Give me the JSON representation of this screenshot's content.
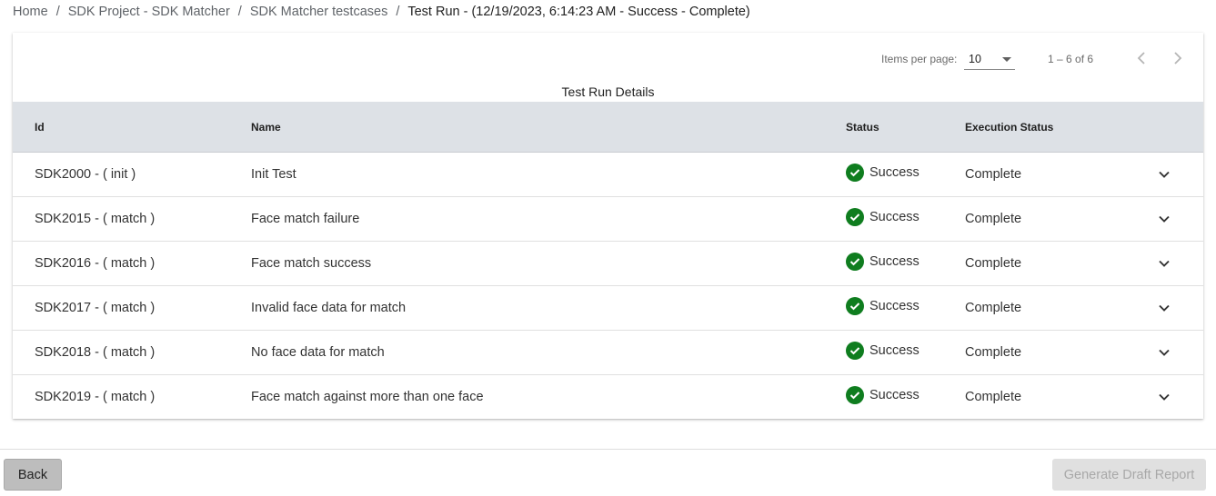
{
  "breadcrumb": [
    {
      "label": "Home"
    },
    {
      "label": "SDK Project - SDK Matcher"
    },
    {
      "label": "SDK Matcher testcases"
    },
    {
      "label": "Test Run - (12/19/2023, 6:14:23 AM - Success - Complete)"
    }
  ],
  "paginator": {
    "items_per_page_label": "Items per page:",
    "items_per_page_value": "10",
    "range_label": "1 – 6 of 6"
  },
  "table": {
    "title": "Test Run Details",
    "headers": {
      "id": "Id",
      "name": "Name",
      "status": "Status",
      "execution_status": "Execution Status"
    },
    "rows": [
      {
        "id": "SDK2000 - ( init )",
        "name": "Init Test",
        "status": "Success",
        "execution_status": "Complete"
      },
      {
        "id": "SDK2015 - ( match )",
        "name": "Face match failure",
        "status": "Success",
        "execution_status": "Complete"
      },
      {
        "id": "SDK2016 - ( match )",
        "name": "Face match success",
        "status": "Success",
        "execution_status": "Complete"
      },
      {
        "id": "SDK2017 - ( match )",
        "name": "Invalid face data for match",
        "status": "Success",
        "execution_status": "Complete"
      },
      {
        "id": "SDK2018 - ( match )",
        "name": "No face data for match",
        "status": "Success",
        "execution_status": "Complete"
      },
      {
        "id": "SDK2019 - ( match )",
        "name": "Face match against more than one face",
        "status": "Success",
        "execution_status": "Complete"
      }
    ]
  },
  "icons": {
    "status": "check-circle-icon",
    "expand": "chevron-down-icon",
    "prev": "chevron-left-icon",
    "next": "chevron-right-icon",
    "select": "caret-down-icon"
  },
  "colors": {
    "success": "#0f7d1f",
    "header_bg": "#dde1e6"
  },
  "actions": {
    "back_label": "Back",
    "generate_label": "Generate Draft Report"
  }
}
